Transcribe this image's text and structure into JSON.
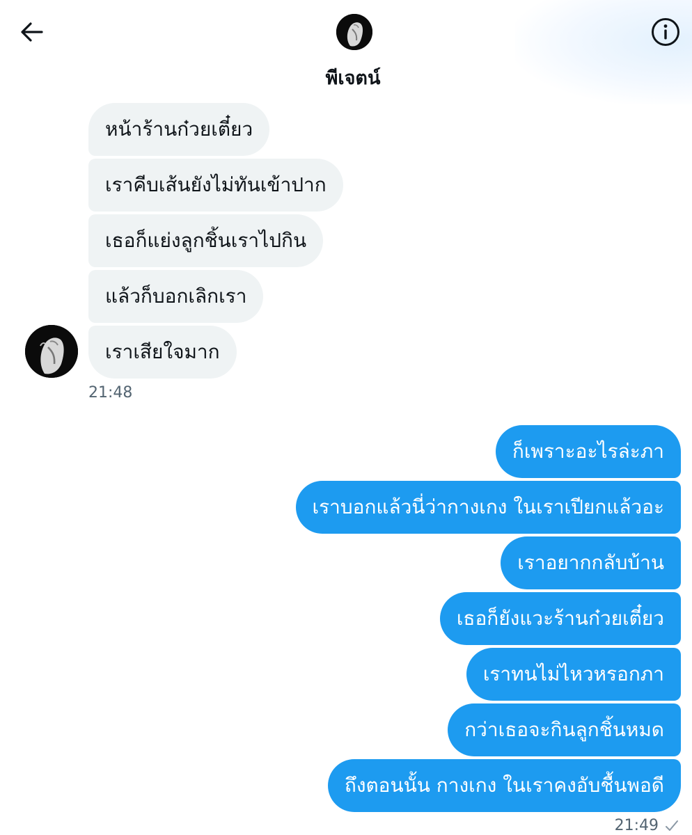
{
  "header": {
    "contact_name": "พีเจตน์"
  },
  "icons": {
    "back": "arrow-left-icon",
    "info": "info-circle-icon",
    "read_receipt": "checkmark-icon"
  },
  "colors": {
    "outgoing_bubble": "#1d9bf0",
    "incoming_bubble": "#eff3f4",
    "timestamp": "#536471"
  },
  "conversation": {
    "incoming": {
      "messages": [
        "หน้าร้านก๋วยเตี๋ยว",
        "เราคีบเส้นยังไม่ทันเข้าปาก",
        "เธอก็แย่งลูกชิ้นเราไปกิน",
        "แล้วก็บอกเลิกเรา",
        "เราเสียใจมาก"
      ],
      "time": "21:48"
    },
    "outgoing": {
      "messages": [
        "ก็เพราะอะไรล่ะภา",
        "เราบอกแล้วนี่ว่ากางเกง ในเราเปียกแล้วอะ",
        "เราอยากกลับบ้าน",
        "เธอก็ยังแวะร้านก๋วยเตี๋ยว",
        "เราทนไม่ไหวหรอกภา",
        "กว่าเธอจะกินลูกชิ้นหมด",
        "ถึงตอนนั้น กางเกง ในเราคงอับชื้นพอดี"
      ],
      "time": "21:49"
    }
  }
}
